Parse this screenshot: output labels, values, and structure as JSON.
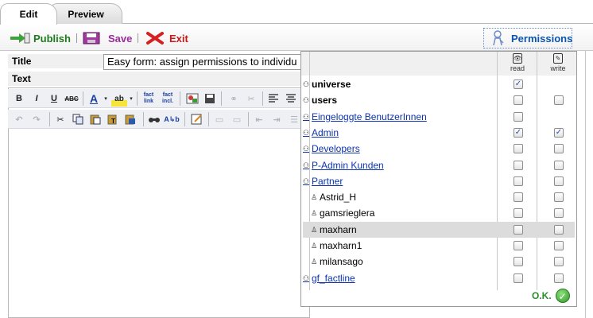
{
  "tabs": {
    "edit": "Edit",
    "preview": "Preview"
  },
  "toolbar": {
    "publish": "Publish",
    "save": "Save",
    "exit": "Exit",
    "permissions": "Permissions"
  },
  "form": {
    "title_label": "Title",
    "title_value": "Easy form: assign permissions to individu",
    "text_label": "Text"
  },
  "editor_toolbar": {
    "row1": [
      "B",
      "I",
      "U",
      "ABC",
      "A",
      "ab",
      "fact link",
      "fact incl."
    ],
    "row2": [
      "undo",
      "redo",
      "cut",
      "copy",
      "paste",
      "paste-text",
      "paste-word",
      "find",
      "replace"
    ]
  },
  "permissions": {
    "read_label": "read",
    "write_label": "write",
    "ok_label": "O.K.",
    "rows": [
      {
        "name": "universe",
        "kind": "group",
        "read": true,
        "write": null
      },
      {
        "name": "users",
        "kind": "group",
        "read": false,
        "write": false
      },
      {
        "name": "Eingeloggte BenutzerInnen",
        "kind": "link",
        "read": false,
        "write": null
      },
      {
        "name": "Admin",
        "kind": "link",
        "read": true,
        "write": true
      },
      {
        "name": "Developers",
        "kind": "link",
        "read": false,
        "write": false
      },
      {
        "name": "P-Admin Kunden",
        "kind": "link",
        "read": false,
        "write": false
      },
      {
        "name": "Partner",
        "kind": "link",
        "read": false,
        "write": false
      },
      {
        "name": "Astrid_H",
        "kind": "user",
        "read": false,
        "write": false
      },
      {
        "name": "gamsrieglera",
        "kind": "user",
        "read": false,
        "write": false
      },
      {
        "name": "maxharn",
        "kind": "user",
        "read": false,
        "write": false,
        "highlight": true
      },
      {
        "name": "maxharn1",
        "kind": "user",
        "read": false,
        "write": false
      },
      {
        "name": "milansago",
        "kind": "user",
        "read": false,
        "write": false
      },
      {
        "name": "gf_factline",
        "kind": "link",
        "read": false,
        "write": false
      }
    ]
  }
}
